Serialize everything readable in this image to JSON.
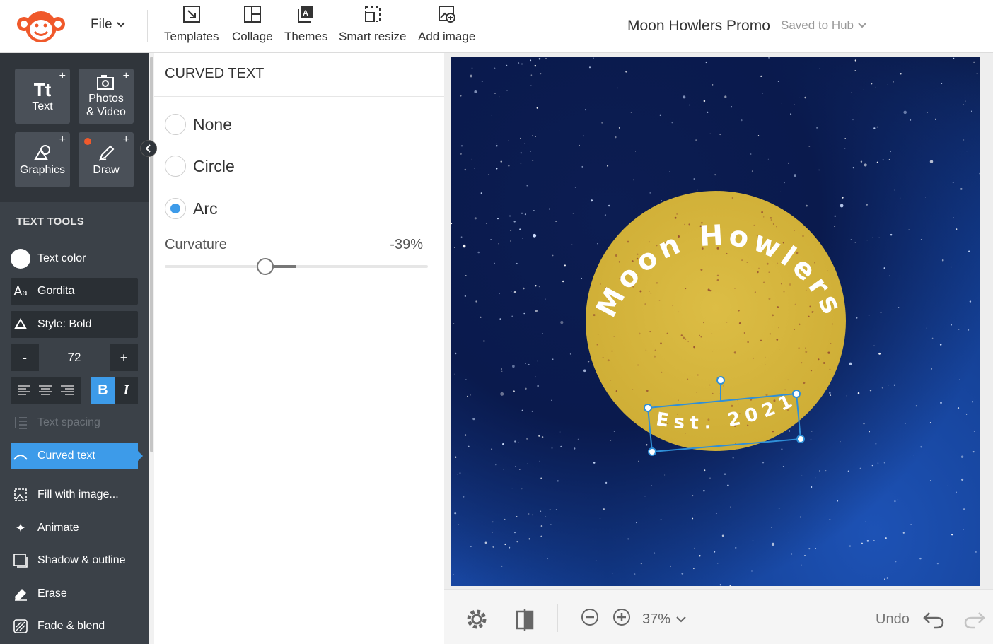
{
  "topbar": {
    "file_label": "File",
    "tools": [
      {
        "label": "Templates",
        "icon": "templates-icon"
      },
      {
        "label": "Collage",
        "icon": "collage-icon"
      },
      {
        "label": "Themes",
        "icon": "themes-icon"
      },
      {
        "label": "Smart resize",
        "icon": "smart-resize-icon"
      },
      {
        "label": "Add image",
        "icon": "add-image-icon"
      }
    ],
    "doc_title": "Moon Howlers Promo",
    "save_status": "Saved to Hub"
  },
  "sidebar": {
    "buttons": [
      {
        "label_line1": "Tt",
        "label_line2": "Text"
      },
      {
        "label_line1": "Photos",
        "label_line2": "& Video"
      },
      {
        "label": "Graphics"
      },
      {
        "label": "Draw"
      }
    ],
    "section_title": "TEXT TOOLS",
    "text_color_label": "Text color",
    "font_label": "Gordita",
    "style_label": "Style: Bold",
    "font_size": "72",
    "stepper_minus": "-",
    "stepper_plus": "+",
    "bold_label": "B",
    "italic_label": "I",
    "items": [
      {
        "label": "Text spacing"
      },
      {
        "label": "Curved text"
      },
      {
        "label": "Fill with image..."
      },
      {
        "label": "Animate"
      },
      {
        "label": "Shadow & outline"
      },
      {
        "label": "Erase"
      },
      {
        "label": "Fade & blend"
      }
    ]
  },
  "panel": {
    "title": "CURVED TEXT",
    "options": [
      {
        "label": "None",
        "checked": false
      },
      {
        "label": "Circle",
        "checked": false
      },
      {
        "label": "Arc",
        "checked": true
      }
    ],
    "curvature_label": "Curvature",
    "curvature_value": "-39%",
    "curvature": -0.39
  },
  "canvas": {
    "headline": "Moon Howlers",
    "subline": "Est. 2021",
    "moon_color": "#d6b63d",
    "selection_color": "#2f8fd8"
  },
  "bottombar": {
    "zoom": "37%",
    "undo_label": "Undo"
  }
}
